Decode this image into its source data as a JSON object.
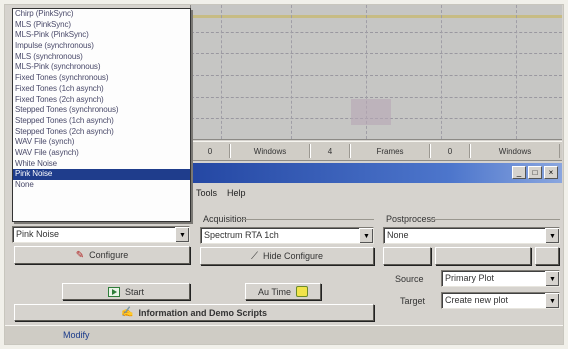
{
  "noise_menu": {
    "options": [
      "Chirp (PinkSync)",
      "MLS (PinkSync)",
      "MLS-Pink (PinkSync)",
      "Impulse (synchronous)",
      "MLS (synchronous)",
      "MLS-Pink (synchronous)",
      "Fixed Tones (synchronous)",
      "Fixed Tones (1ch asynch)",
      "Fixed Tones (2ch asynch)",
      "Stepped Tones (synchronous)",
      "Stepped Tones (1ch asynch)",
      "Stepped Tones (2ch asynch)",
      "WAV File (synch)",
      "WAV File (asynch)",
      "White Noise",
      "Pink Noise",
      "None"
    ],
    "selected_index": 15
  },
  "status_strip": {
    "cells": [
      "0",
      "Windows",
      "4",
      "Frames",
      "0",
      "Windows"
    ]
  },
  "menubar": {
    "items": [
      "Tools",
      "Help"
    ]
  },
  "generator": {
    "selected": "Pink Noise",
    "configure_label": "Configure"
  },
  "acquisition": {
    "label": "Acquisition",
    "selected": "Spectrum RTA 1ch",
    "hide_configure_label": "Hide Configure"
  },
  "postprocess": {
    "label": "Postprocess",
    "selected": "None"
  },
  "controls": {
    "start_label": "Start",
    "autotime_label": "Au Time"
  },
  "source": {
    "label": "Source",
    "selected": "Primary Plot"
  },
  "target": {
    "label": "Target",
    "selected": "Create new plot"
  },
  "info_button_label": "Information and Demo Scripts",
  "bottom": {
    "text": "Modify"
  },
  "colors": {
    "selection": "#1f3d8c",
    "titlebar": "#2447a3",
    "face": "#d6d3ce"
  }
}
